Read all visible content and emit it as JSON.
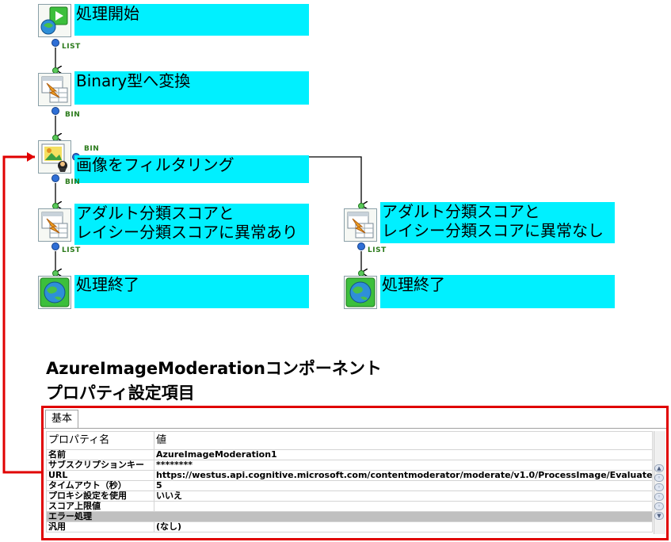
{
  "colors": {
    "label_fill": "#00f0ff",
    "connector_text": "#2a7a1a",
    "connector_dot": "#2f6fd6",
    "highlight": "#e00000",
    "group_row": "#c0c0c0"
  },
  "flow": {
    "nodes": [
      {
        "id": "start",
        "icon": "start-play-icon",
        "lines": [
          "処理開始"
        ]
      },
      {
        "id": "to-binary",
        "icon": "convert-table-icon",
        "lines": [
          "Binary型へ変換"
        ]
      },
      {
        "id": "filter",
        "icon": "image-filter-icon",
        "lines": [
          "画像をフィルタリング"
        ]
      },
      {
        "id": "abnormal",
        "icon": "convert-table-icon",
        "lines": [
          "アダルト分類スコアと",
          "レイシー分類スコアに異常あり"
        ]
      },
      {
        "id": "end-left",
        "icon": "globe-end-icon",
        "lines": [
          "処理終了"
        ]
      },
      {
        "id": "normal",
        "icon": "convert-table-icon",
        "lines": [
          "アダルト分類スコアと",
          "レイシー分類スコアに異常なし"
        ]
      },
      {
        "id": "end-right",
        "icon": "globe-end-icon",
        "lines": [
          "処理終了"
        ]
      }
    ],
    "connectors": [
      {
        "from": "start",
        "to": "to-binary",
        "label": "LIST"
      },
      {
        "from": "to-binary",
        "to": "filter",
        "label": "BIN"
      },
      {
        "from": "filter",
        "to": "abnormal",
        "label": "BIN"
      },
      {
        "from": "filter",
        "to": "normal",
        "label": "BIN"
      },
      {
        "from": "abnormal",
        "to": "end-left",
        "label": "LIST"
      },
      {
        "from": "normal",
        "to": "end-right",
        "label": "LIST"
      }
    ]
  },
  "section": {
    "title_line1": "AzureImageModerationコンポーネント",
    "title_line2": "プロパティ設定項目"
  },
  "properties": {
    "tab": "基本",
    "header_name": "プロパティ名",
    "header_value": "値",
    "rows": [
      {
        "name": "名前",
        "value": "AzureImageModeration1"
      },
      {
        "name": "サブスクリプションキー",
        "value": "********"
      },
      {
        "name": "URL",
        "value": "https://westus.api.cognitive.microsoft.com/contentmoderator/moderate/v1.0/ProcessImage/Evaluate"
      },
      {
        "name": "タイムアウト（秒）",
        "value": "5"
      },
      {
        "name": "プロキシ設定を使用",
        "value": "いいえ"
      },
      {
        "name": "スコア上限値",
        "value": ""
      }
    ],
    "group": "エラー処理",
    "group_rows": [
      {
        "name": "汎用",
        "value": "(なし)"
      }
    ]
  }
}
